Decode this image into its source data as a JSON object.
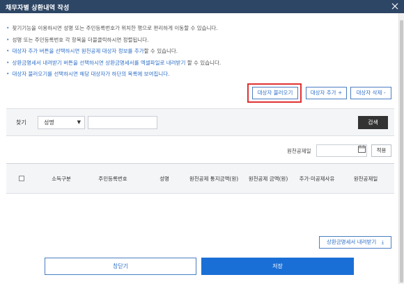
{
  "window": {
    "title": "채무자별 상환내역 작성"
  },
  "info_lines": [
    {
      "segments": [
        {
          "text": "찾기기능을 이용하시면 성명 또는 주민등록번호가 위치한 행으로 편리하게 이동할 수 있습니다.",
          "highlight": false
        }
      ]
    },
    {
      "segments": [
        {
          "text": "성명 또는 주민등록번호 각 항목을 더블클릭하시면 정렬됩니다.",
          "highlight": false
        }
      ]
    },
    {
      "segments": [
        {
          "text": "대상자 추가 버튼을 선택하시면 ",
          "highlight": true
        },
        {
          "text": "원천공제 대상자 정보를 추가",
          "highlight": true
        },
        {
          "text": "할 수 있습니다.",
          "highlight": false
        }
      ]
    },
    {
      "segments": [
        {
          "text": "상환금명세서 내려받기 버튼을 선택하시면 ",
          "highlight": true
        },
        {
          "text": "상환금명세서를 엑셀파일로 내려받기",
          "highlight": true
        },
        {
          "text": " 할 수 있습니다.",
          "highlight": false
        }
      ]
    },
    {
      "segments": [
        {
          "text": "대상자 불러오기를 선택하시면 해당 대상자가 ",
          "highlight": true
        },
        {
          "text": "하단의 목록에 보여집니다.",
          "highlight": true
        }
      ]
    }
  ],
  "actions": {
    "load": "대상자 불러오기",
    "add": "대상자 추가 +",
    "delete": "대상자 삭제 -"
  },
  "search": {
    "label": "찾기",
    "field_selected": "성명",
    "value": "",
    "button": "검색"
  },
  "date_filter": {
    "label": "원천공제일",
    "value": "",
    "apply": "적용"
  },
  "table": {
    "columns": [
      "소득구분",
      "주민등록번호",
      "성명",
      "원천공제 통지금액(원)",
      "원천공제 금액(원)",
      "추가·미공제사유",
      "원천공제일"
    ],
    "rows": []
  },
  "footer": {
    "receipt_download": "상환금명세서 내려받기",
    "close": "창닫기",
    "save": "저장"
  },
  "colors": {
    "titlebar": "#2e4665",
    "accent": "#1a6fd6",
    "highlight_box": "#e03131"
  }
}
